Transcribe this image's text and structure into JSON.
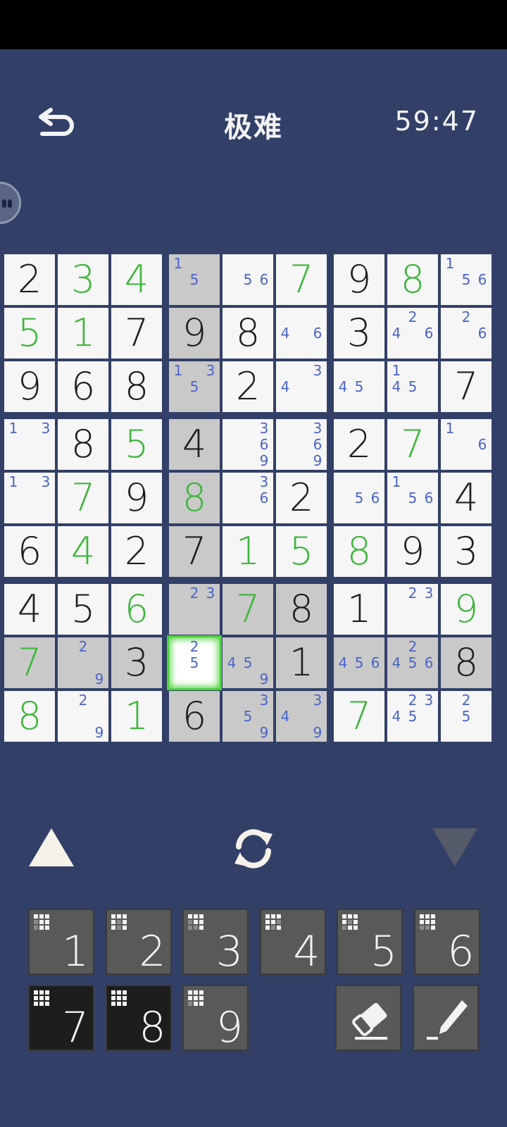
{
  "header": {
    "title": "极难",
    "timer": "59:47"
  },
  "colors": {
    "background": "#324068",
    "given": "#1e1e1e",
    "user": "#3cb63a",
    "note": "#4a64c8",
    "highlight": "#c9c9c9",
    "selected_border": "#4bd13b"
  },
  "board": {
    "rows": [
      [
        {
          "v": "2",
          "t": "given"
        },
        {
          "v": "3",
          "t": "user"
        },
        {
          "v": "4",
          "t": "user"
        },
        {
          "n": [
            1,
            5
          ],
          "h": 1
        },
        {
          "n": [
            5,
            6
          ]
        },
        {
          "v": "7",
          "t": "user"
        },
        {
          "v": "9",
          "t": "given"
        },
        {
          "v": "8",
          "t": "user"
        },
        {
          "n": [
            1,
            5,
            6
          ]
        }
      ],
      [
        {
          "v": "5",
          "t": "user"
        },
        {
          "v": "1",
          "t": "user"
        },
        {
          "v": "7",
          "t": "given"
        },
        {
          "v": "9",
          "t": "given",
          "h": 1
        },
        {
          "v": "8",
          "t": "given"
        },
        {
          "n": [
            4,
            6
          ]
        },
        {
          "v": "3",
          "t": "given"
        },
        {
          "n": [
            2,
            4,
            6
          ]
        },
        {
          "n": [
            2,
            6
          ]
        }
      ],
      [
        {
          "v": "9",
          "t": "given"
        },
        {
          "v": "6",
          "t": "given"
        },
        {
          "v": "8",
          "t": "given"
        },
        {
          "n": [
            1,
            3,
            5
          ],
          "h": 1
        },
        {
          "v": "2",
          "t": "given"
        },
        {
          "n": [
            3,
            4
          ]
        },
        {
          "n": [
            4,
            5
          ]
        },
        {
          "n": [
            1,
            4,
            5
          ]
        },
        {
          "v": "7",
          "t": "given"
        }
      ],
      [
        {
          "n": [
            1,
            3
          ]
        },
        {
          "v": "8",
          "t": "given"
        },
        {
          "v": "5",
          "t": "user"
        },
        {
          "v": "4",
          "t": "given",
          "h": 1
        },
        {
          "n": [
            3,
            6,
            9
          ]
        },
        {
          "n": [
            3,
            6,
            9
          ]
        },
        {
          "v": "2",
          "t": "given"
        },
        {
          "v": "7",
          "t": "user"
        },
        {
          "n": [
            1,
            6
          ]
        }
      ],
      [
        {
          "n": [
            1,
            3
          ]
        },
        {
          "v": "7",
          "t": "user"
        },
        {
          "v": "9",
          "t": "given"
        },
        {
          "v": "8",
          "t": "user",
          "h": 1
        },
        {
          "n": [
            3,
            6
          ]
        },
        {
          "v": "2",
          "t": "given"
        },
        {
          "n": [
            5,
            6
          ]
        },
        {
          "n": [
            1,
            5,
            6
          ]
        },
        {
          "v": "4",
          "t": "given"
        }
      ],
      [
        {
          "v": "6",
          "t": "given"
        },
        {
          "v": "4",
          "t": "user"
        },
        {
          "v": "2",
          "t": "given"
        },
        {
          "v": "7",
          "t": "given",
          "h": 1
        },
        {
          "v": "1",
          "t": "user"
        },
        {
          "v": "5",
          "t": "user"
        },
        {
          "v": "8",
          "t": "user"
        },
        {
          "v": "9",
          "t": "given"
        },
        {
          "v": "3",
          "t": "given"
        }
      ],
      [
        {
          "v": "4",
          "t": "given"
        },
        {
          "v": "5",
          "t": "given"
        },
        {
          "v": "6",
          "t": "user"
        },
        {
          "n": [
            2,
            3
          ],
          "h": 1
        },
        {
          "v": "7",
          "t": "user",
          "h": 1
        },
        {
          "v": "8",
          "t": "given",
          "h": 1
        },
        {
          "v": "1",
          "t": "given"
        },
        {
          "n": [
            2,
            3
          ]
        },
        {
          "v": "9",
          "t": "user"
        }
      ],
      [
        {
          "v": "7",
          "t": "user",
          "h": 1
        },
        {
          "n": [
            2,
            9
          ],
          "h": 1
        },
        {
          "v": "3",
          "t": "given",
          "h": 1
        },
        {
          "n": [
            2,
            5
          ],
          "sel": 1
        },
        {
          "n": [
            4,
            5,
            9
          ],
          "h": 1
        },
        {
          "v": "1",
          "t": "given",
          "h": 1
        },
        {
          "n": [
            4,
            5,
            6
          ],
          "h": 1
        },
        {
          "n": [
            2,
            4,
            5,
            6
          ],
          "h": 1
        },
        {
          "v": "8",
          "t": "given",
          "h": 1
        }
      ],
      [
        {
          "v": "8",
          "t": "user"
        },
        {
          "n": [
            2,
            9
          ]
        },
        {
          "v": "1",
          "t": "user"
        },
        {
          "v": "6",
          "t": "given",
          "h": 1
        },
        {
          "n": [
            3,
            5,
            9
          ],
          "h": 1
        },
        {
          "n": [
            3,
            4,
            9
          ],
          "h": 1
        },
        {
          "v": "7",
          "t": "user"
        },
        {
          "n": [
            2,
            3,
            4,
            5
          ]
        },
        {
          "n": [
            2,
            5
          ]
        }
      ]
    ]
  },
  "tools": {
    "prev_icon": "triangle-up-icon",
    "refresh_icon": "refresh-icon",
    "next_icon": "triangle-down-icon"
  },
  "numpad": {
    "keys": [
      {
        "label": "1",
        "remaining": [
          1,
          1,
          1,
          0,
          1,
          1,
          0,
          1,
          1
        ],
        "dark": false
      },
      {
        "label": "2",
        "remaining": [
          1,
          1,
          1,
          1,
          0,
          1,
          1,
          0,
          1
        ],
        "dark": false
      },
      {
        "label": "3",
        "remaining": [
          1,
          1,
          1,
          0,
          1,
          1,
          0,
          0,
          1
        ],
        "dark": false
      },
      {
        "label": "4",
        "remaining": [
          1,
          1,
          1,
          1,
          1,
          0,
          1,
          0,
          1
        ],
        "dark": false
      },
      {
        "label": "5",
        "remaining": [
          1,
          1,
          1,
          1,
          0,
          1,
          0,
          1,
          1
        ],
        "dark": false
      },
      {
        "label": "6",
        "remaining": [
          1,
          1,
          1,
          1,
          1,
          1,
          0,
          0,
          1
        ],
        "dark": false
      },
      {
        "label": "7",
        "remaining": [
          1,
          1,
          1,
          1,
          1,
          1,
          1,
          1,
          1
        ],
        "dark": true
      },
      {
        "label": "8",
        "remaining": [
          1,
          1,
          1,
          1,
          1,
          1,
          1,
          1,
          1
        ],
        "dark": true
      },
      {
        "label": "9",
        "remaining": [
          1,
          1,
          1,
          1,
          1,
          1,
          0,
          1,
          1
        ],
        "dark": false
      }
    ],
    "eraser_icon": "eraser-icon",
    "pencil_icon": "pencil-icon"
  }
}
